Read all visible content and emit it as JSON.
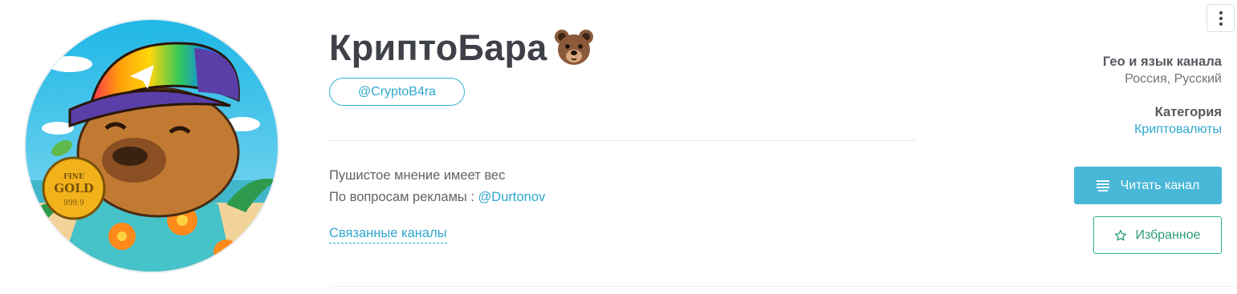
{
  "channel": {
    "title": "КриптоБара",
    "title_emoji": "bear-face",
    "handle": "@CryptoB4ra",
    "description_line1": "Пушистое мнение имеет вес",
    "description_line2_prefix": "По вопросам рекламы : ",
    "description_line2_link": "@Durtonov",
    "related_label": "Связанные каналы",
    "avatar_coin_text": [
      "FINE",
      "GOLD",
      "999.9"
    ]
  },
  "info": {
    "geo_label": "Гео и язык канала",
    "geo_value": "Россия, Русский",
    "category_label": "Категория",
    "category_value": "Криптовалюты"
  },
  "actions": {
    "read_label": "Читать канал",
    "read_icon": "lines-icon",
    "favorite_label": "Избранное",
    "favorite_icon": "star-outline-icon",
    "menu_icon": "vertical-dots-icon"
  },
  "colors": {
    "accent": "#48b7d8",
    "link": "#2fa7cf",
    "favorite": "#2bb28b",
    "title": "#3f4148"
  }
}
